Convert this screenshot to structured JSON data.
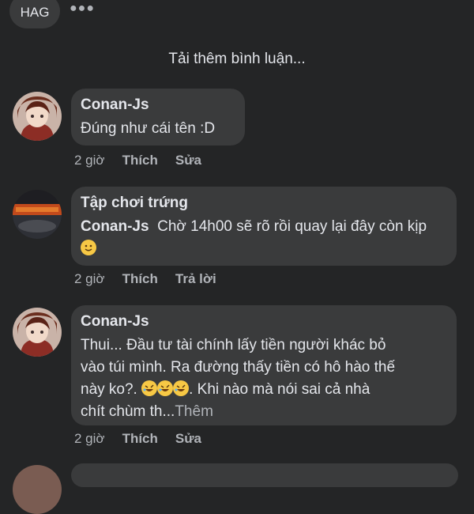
{
  "header": {
    "chip_label": "HAG",
    "more_icon": "ellipsis-icon"
  },
  "load_more": "Tải thêm bình luận...",
  "comments": [
    {
      "author": "Conan-Js",
      "text": "Đúng như cái tên :D",
      "time": "2 giờ",
      "like_label": "Thích",
      "second_action": "Sửa"
    },
    {
      "author": "Tập chơi trứng",
      "mention": "Conan-Js",
      "text": "Chờ 14h00 sẽ rõ rồi quay lại đây còn kịp",
      "emoji": "slightly-smiling-face",
      "time": "2 giờ",
      "like_label": "Thích",
      "second_action": "Trả lời"
    },
    {
      "author": "Conan-Js",
      "text_line1": "Thui... Đầu tư tài chính lấy tiền người khác bỏ",
      "text_line2": "vào túi mình. Ra đường thấy tiền có hô hào thế",
      "text_line3_a": "này ko?.",
      "text_line3_b": ". Khi nào mà nói sai cả nhà",
      "text_line4": "chít chùm th...",
      "see_more": "Thêm",
      "emoji": "rolling-on-floor-laughing",
      "time": "2 giờ",
      "like_label": "Thích",
      "second_action": "Sửa"
    }
  ],
  "colors": {
    "background": "#242526",
    "bubble": "#3a3b3c",
    "text": "#e4e6eb",
    "secondary": "#b0b3b8"
  }
}
